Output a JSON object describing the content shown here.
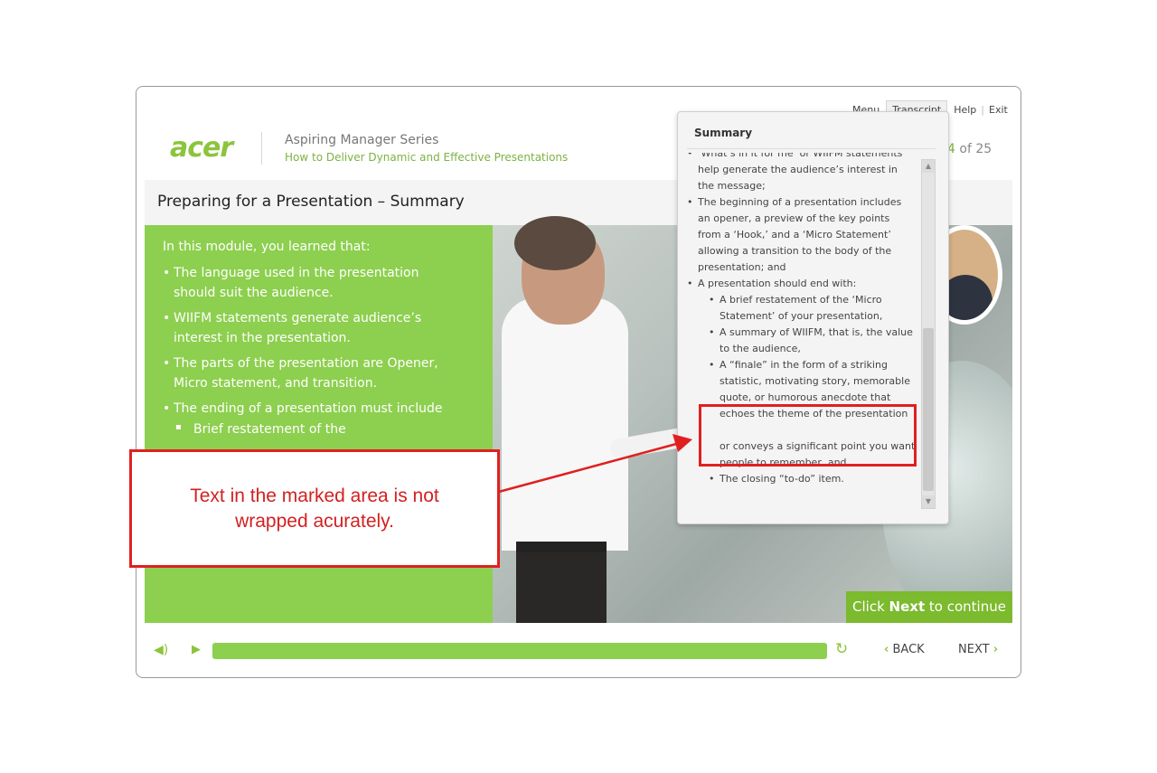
{
  "topnav": {
    "menu": "Menu",
    "transcript": "Transcript",
    "help": "Help",
    "exit": "Exit"
  },
  "header": {
    "logo": "acer",
    "series": "Aspiring Manager Series",
    "course": "How to Deliver Dynamic and Effective Presentations",
    "page_current": "4",
    "page_of": " of 25"
  },
  "slide": {
    "title": "Preparing for a Presentation – Summary",
    "intro": "In this module, you learned that:",
    "points": [
      "The language used in the presentation should suit the audience.",
      "WIIFM statements generate audience’s interest in the presentation.",
      "The parts of the presentation are Opener, Micro statement, and transition.",
      "The ending of a presentation must include"
    ],
    "subpoint": "Brief restatement of the",
    "click_next_prefix": "Click ",
    "click_next_bold": "Next",
    "click_next_suffix": " to continue"
  },
  "controls": {
    "back": "BACK",
    "next": "NEXT",
    "progress": 1.0
  },
  "transcript": {
    "heading": "Summary",
    "items": [
      "‘What’s in it for me’ or WIIFM statements help generate the audience’s interest in the message;",
      "The beginning of a presentation includes an opener, a preview of the key points from a ‘Hook,’ and a ‘Micro Statement’ allowing a transition to the body of the presentation; and",
      "A presentation should end with:"
    ],
    "subitems": [
      "A brief restatement of the ‘Micro Statement’ of your presentation,",
      "A summary of WIIFM, that is, the value to the audience,",
      "A “finale” in the form of a striking statistic, motivating story, memorable quote, or humorous anecdote that echoes the theme of the presentation",
      "or conveys a significant point you want people to remember, and",
      "The closing “to-do” item."
    ]
  },
  "callout": {
    "text": "Text in the marked area is not wrapped acurately."
  },
  "colors": {
    "brand_green": "#8dcf4f",
    "annotation_red": "#e02020"
  },
  "icons": [
    "volume-icon",
    "play-icon",
    "replay-icon",
    "chevron-left-icon",
    "chevron-right-icon",
    "scroll-up-icon",
    "scroll-down-icon"
  ]
}
